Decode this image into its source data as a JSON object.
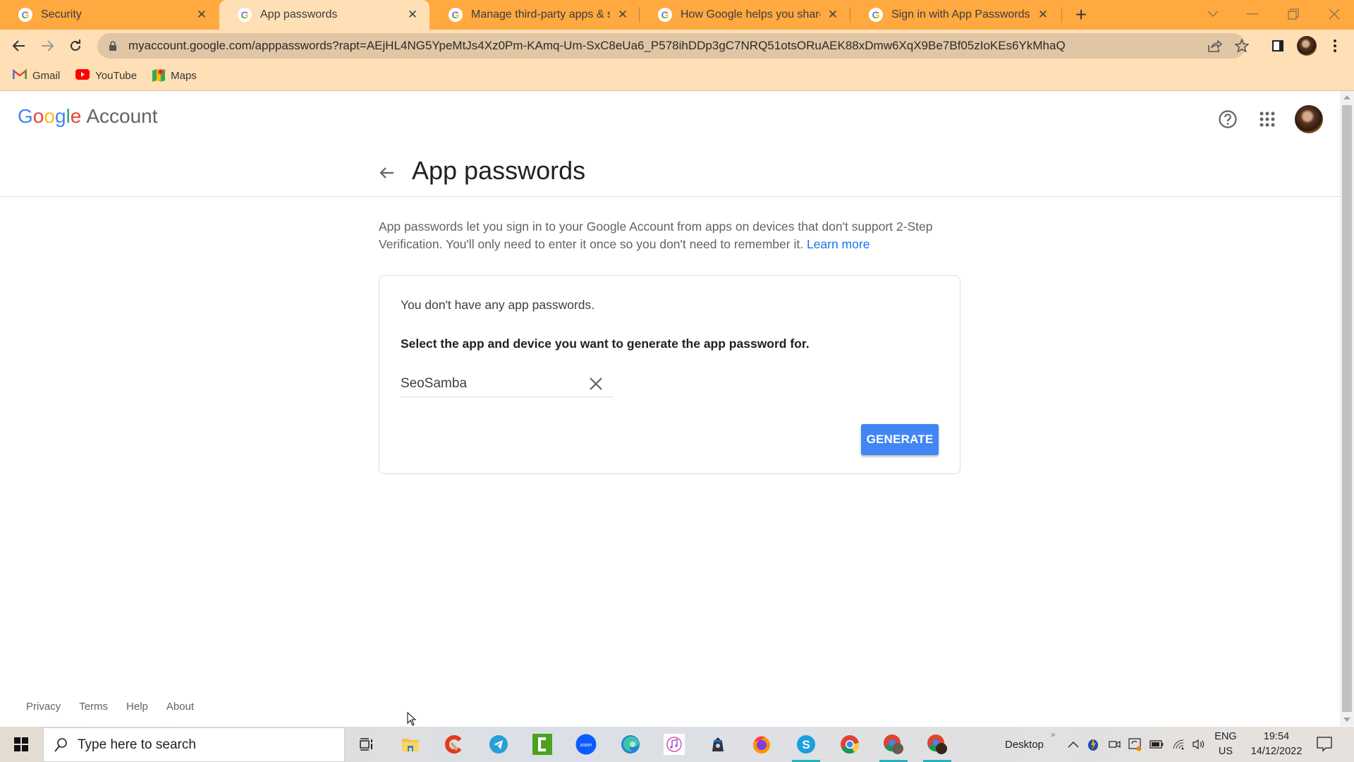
{
  "browser": {
    "tabs": [
      {
        "title": "Security",
        "active": false
      },
      {
        "title": "App passwords",
        "active": true
      },
      {
        "title": "Manage third-party apps & servi",
        "active": false
      },
      {
        "title": "How Google helps you share dat",
        "active": false
      },
      {
        "title": "Sign in with App Passwords - Goo",
        "active": false
      }
    ],
    "new_tab_label": "+",
    "url": "myaccount.google.com/apppasswords?rapt=AEjHL4NG5YpeMtJs4Xz0Pm-KAmq-Um-SxC8eUa6_P578ihDDp3gC7NRQ51otsORuAEK88xDmw6XqX9Be7Bf05zIoKEs6YkMhaQ",
    "bookmarks": [
      {
        "label": "Gmail",
        "icon": "gmail-icon"
      },
      {
        "label": "YouTube",
        "icon": "youtube-icon"
      },
      {
        "label": "Maps",
        "icon": "maps-icon"
      }
    ]
  },
  "header": {
    "logo_letters": [
      "G",
      "o",
      "o",
      "g",
      "l",
      "e"
    ],
    "logo_suffix": "Account",
    "help_icon": "help-icon",
    "apps_icon": "apps-grid-icon"
  },
  "main": {
    "title": "App passwords",
    "description": "App passwords let you sign in to your Google Account from apps on devices that don't support 2-Step Verification. You'll only need to enter it once so you don't need to remember it.",
    "learn_more": "Learn more",
    "card": {
      "empty_message": "You don't have any app passwords.",
      "prompt": "Select the app and device you want to generate the app password for.",
      "app_name_value": "SeoSamba",
      "generate_label": "GENERATE"
    }
  },
  "footer": {
    "links": [
      "Privacy",
      "Terms",
      "Help",
      "About"
    ]
  },
  "taskbar": {
    "search_placeholder": "Type here to search",
    "apps": [
      "task-view",
      "file-explorer",
      "ccleaner",
      "telegram",
      "camtasia",
      "zoom",
      "edge",
      "itunes",
      "vpn-app",
      "firefox",
      "skype",
      "chrome",
      "chrome-profile-1",
      "chrome-profile-2"
    ],
    "zoom_label": "zoom",
    "desktop_label": "Desktop",
    "lang_top": "ENG",
    "lang_bottom": "US",
    "time": "19:54",
    "date": "14/12/2022"
  },
  "colors": {
    "tab_strip": "#ffa940",
    "toolbar": "#ffdfb5",
    "accent_blue": "#4285f4",
    "link_blue": "#1a73e8"
  }
}
